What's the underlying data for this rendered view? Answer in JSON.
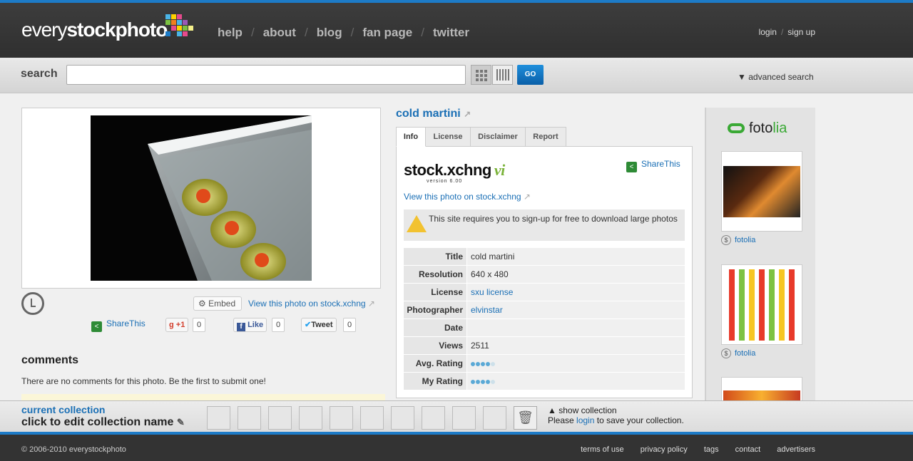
{
  "header": {
    "logo_light": "every",
    "logo_bold": "stockphoto",
    "nav": [
      "help",
      "about",
      "blog",
      "fan page",
      "twitter"
    ],
    "login": "login",
    "signup": "sign up"
  },
  "search": {
    "label": "search",
    "placeholder": "",
    "go": "GO",
    "advanced": "advanced search"
  },
  "photo": {
    "embed": "Embed",
    "view_link": "View this photo on stock.xchng",
    "sharethis": "ShareThis",
    "gplus_count": "0",
    "like": "Like",
    "like_count": "0",
    "tweet": "Tweet",
    "tweet_count": "0"
  },
  "comments": {
    "heading": "comments",
    "empty": "There are no comments for this photo. Be the first to submit one!"
  },
  "detail": {
    "title": "cold martini",
    "tabs": [
      "Info",
      "License",
      "Disclaimer",
      "Report"
    ],
    "brand": "stock.xchng",
    "brand_suffix": "vi",
    "brand_version": "version 6.00",
    "sharethis": "ShareThis",
    "view_link": "View this photo on stock.xchng",
    "warning": "This site requires you to sign-up for free to download large photos",
    "rows": [
      {
        "k": "Title",
        "v": "cold martini"
      },
      {
        "k": "Resolution",
        "v": "640 x 480"
      },
      {
        "k": "License",
        "v": "sxu license"
      },
      {
        "k": "Photographer",
        "v": "elvinstar"
      },
      {
        "k": "Date",
        "v": ""
      },
      {
        "k": "Views",
        "v": "2511"
      },
      {
        "k": "Avg. Rating",
        "v": ""
      },
      {
        "k": "My Rating",
        "v": ""
      }
    ]
  },
  "ad": {
    "brand": "foto",
    "brand_accent": "lia",
    "items": [
      "fotolia",
      "fotolia"
    ]
  },
  "collection": {
    "label": "current collection",
    "name_prompt": "click to edit collection name",
    "show": "show collection",
    "please": "Please",
    "login": "login",
    "save_text": "to save your collection."
  },
  "footer": {
    "copyright": "© 2006-2010 everystockphoto",
    "links": [
      "terms of use",
      "privacy policy",
      "tags",
      "contact",
      "advertisers"
    ]
  },
  "colors": {
    "accent": "#1d7bc7",
    "link": "#1a6fb5",
    "fotolia_green": "#3aa935"
  }
}
